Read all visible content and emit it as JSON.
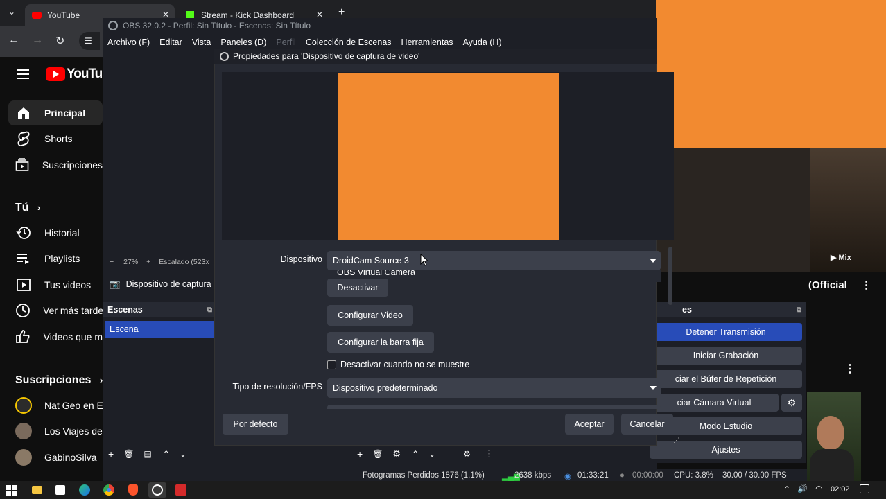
{
  "browser": {
    "tabs": [
      {
        "label": "YouTube"
      },
      {
        "label": "Stream - Kick Dashboard"
      }
    ],
    "new_tab": "+"
  },
  "youtube": {
    "logo": "YouTube",
    "nav": [
      {
        "label": "Principal",
        "icon": "home-icon"
      },
      {
        "label": "Shorts",
        "icon": "shorts-icon"
      },
      {
        "label": "Suscripciones",
        "icon": "subscriptions-icon"
      }
    ],
    "you_header": "Tú",
    "you_items": [
      {
        "label": "Historial",
        "icon": "history-icon"
      },
      {
        "label": "Playlists",
        "icon": "playlist-icon"
      },
      {
        "label": "Tus videos",
        "icon": "video-icon"
      },
      {
        "label": "Ver más tarde",
        "icon": "clock-icon"
      },
      {
        "label": "Videos que m",
        "icon": "thumbs-up-icon"
      }
    ],
    "subs_header": "Suscripciones",
    "channels": [
      {
        "label": "Nat Geo en Es",
        "color": "#f6c700"
      },
      {
        "label": "Los Viajes de",
        "color": "#7a6a5c"
      },
      {
        "label": "GabinoSilva",
        "color": "#8a7966"
      }
    ],
    "right_video_title": "(Official",
    "mix_label": "Mix"
  },
  "obs": {
    "title": "OBS 32.0.2 - Perfil: Sin Título - Escenas: Sin Título",
    "menu": [
      "Archivo (F)",
      "Editar",
      "Vista",
      "Paneles (D)",
      "Perfil",
      "Colección de Escenas",
      "Herramientas",
      "Ayuda (H)"
    ],
    "zoom": "27%",
    "scaled": "Escalado (523x",
    "source_name": "Dispositivo de captura",
    "scenes_header": "Escenas",
    "scene": "Escena",
    "controls_header": "es",
    "controls": [
      "Detener Transmisión",
      "Iniciar Grabación",
      "ciar el Búfer de Repetición",
      "ciar Cámara Virtual",
      "Modo Estudio",
      "Ajustes"
    ],
    "status": {
      "dropped": "Fotogramas Perdidos 1876 (1.1%)",
      "bitrate": "2638 kbps",
      "stream_time": "01:33:21",
      "rec_time": "00:00:00",
      "cpu": "CPU: 3.8%",
      "fps": "30.00 / 30.00 FPS"
    }
  },
  "dialog": {
    "title": "Propiedades para 'Dispositivo de captura de video'",
    "device_label": "Dispositivo",
    "device_value": "DroidCam Source 3",
    "dropdown_option": "OBS Virtual Camera",
    "deactivate": "Desactivar",
    "configure_video": "Configurar Video",
    "configure_bar": "Configurar la barra fija",
    "hide_checkbox": "Desactivar cuando no se muestre",
    "hide_checked": false,
    "res_label": "Tipo de resolución/FPS",
    "res_value": "Dispositivo predeterminado",
    "defaults": "Por defecto",
    "ok": "Aceptar",
    "cancel": "Cancelar",
    "preview_color": "#f28a30"
  },
  "taskbar": {
    "time": "02:02"
  }
}
